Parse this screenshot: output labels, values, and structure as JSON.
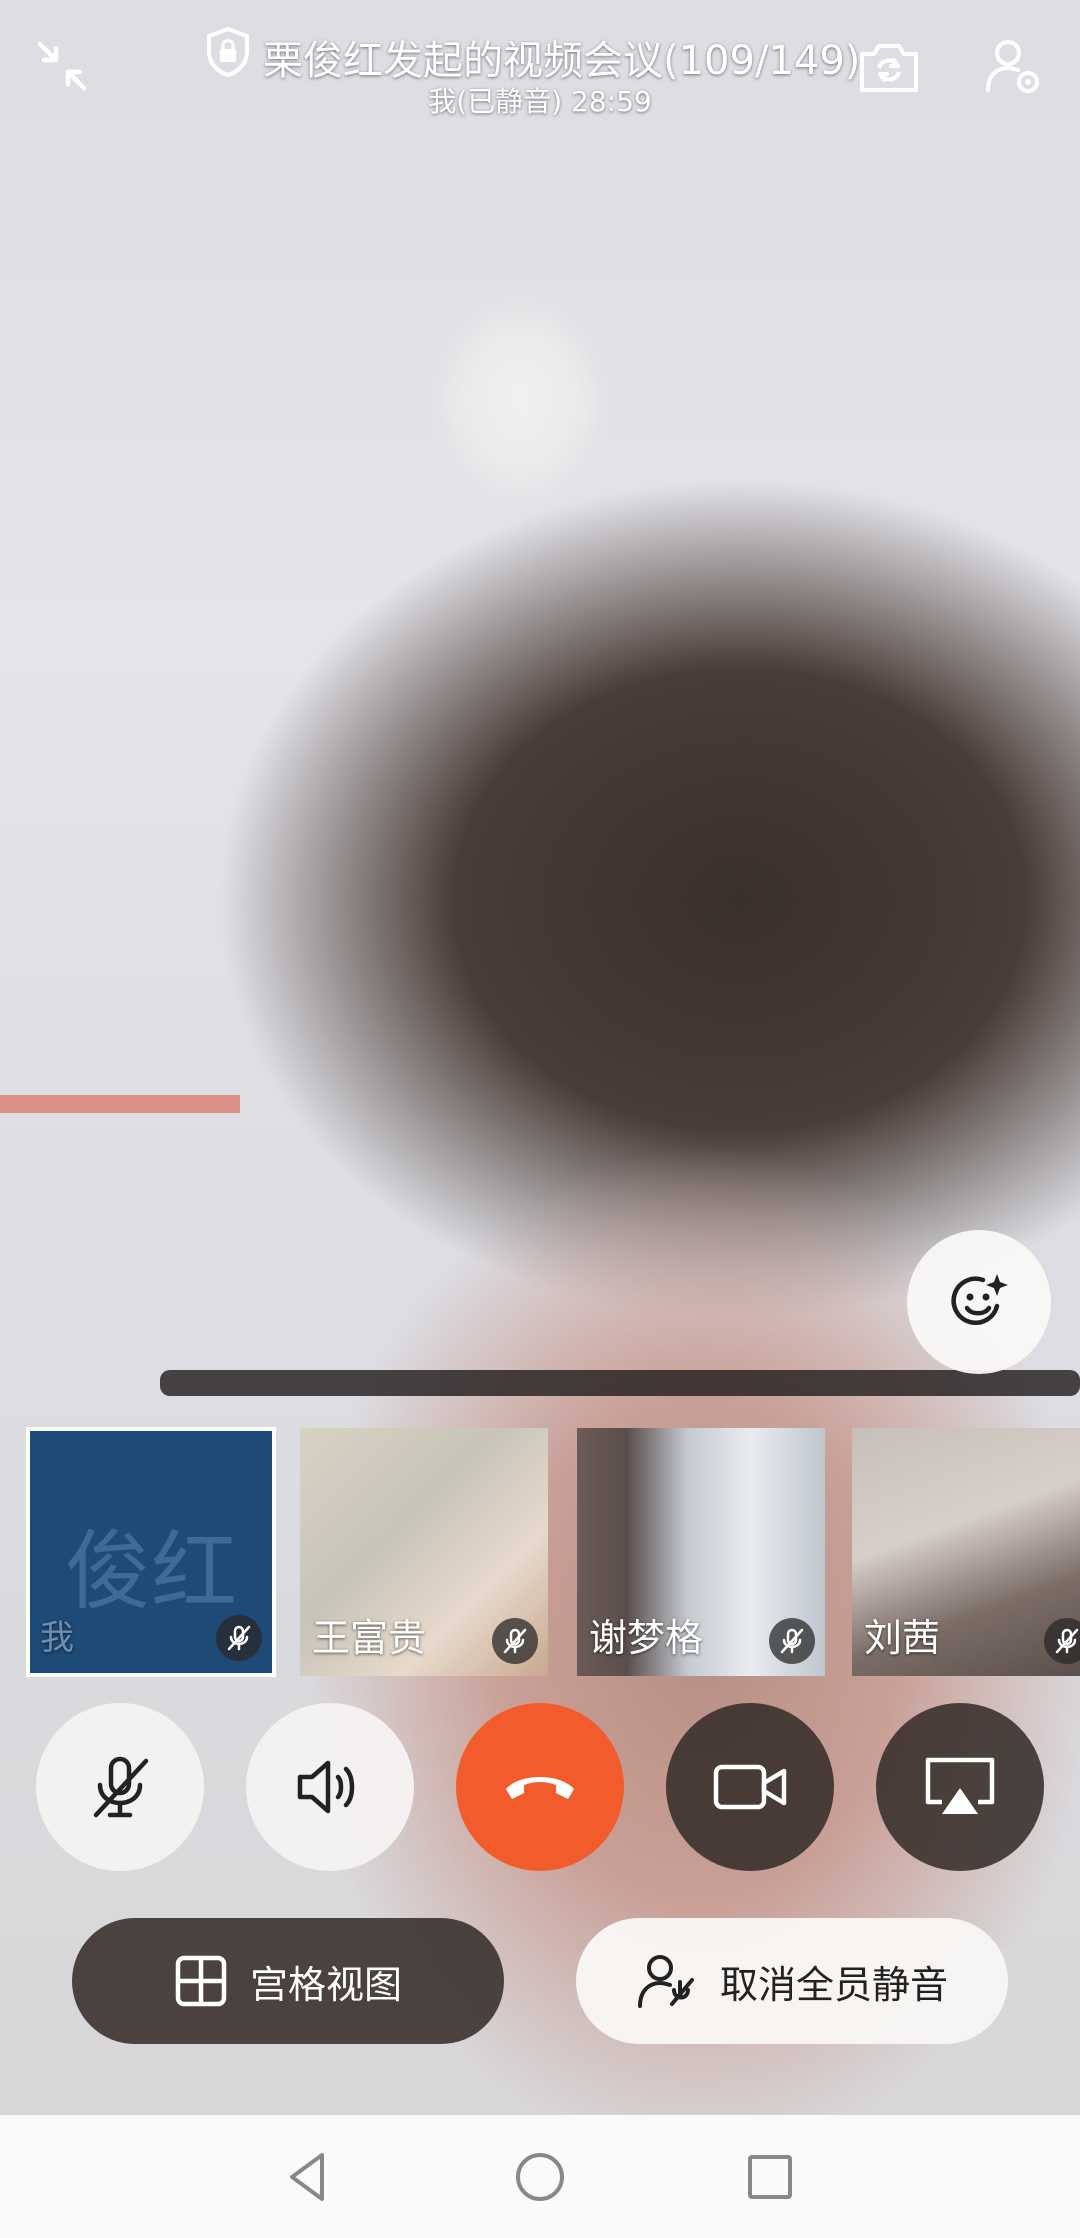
{
  "meeting": {
    "title": "栗俊红发起的视频会议(109/149)",
    "status": "我(已静音) 28:59"
  },
  "thumbnails": [
    {
      "name": "我",
      "avatar_text": "俊红",
      "muted": true,
      "selected": true
    },
    {
      "name": "王富贵",
      "muted": true
    },
    {
      "name": "谢梦格",
      "muted": true
    },
    {
      "name": "刘茜",
      "muted": true
    }
  ],
  "controls": {
    "mic": "muted",
    "speaker": "on",
    "hangup_color": "#f25c2c",
    "camera": "on",
    "share": "screen-share"
  },
  "pills": {
    "grid_view_label": "宫格视图",
    "unmute_all_label": "取消全员静音"
  },
  "icons": {
    "exit_fullscreen": "collapse-icon",
    "lock": "shield-lock-icon",
    "flip_camera": "flip-camera-icon",
    "participants": "participants-settings-icon",
    "beauty": "face-beauty-icon"
  },
  "colors": {
    "hangup": "#f25c2c",
    "self_tile": "#1e4a78",
    "dark_button": "#372d2a"
  }
}
